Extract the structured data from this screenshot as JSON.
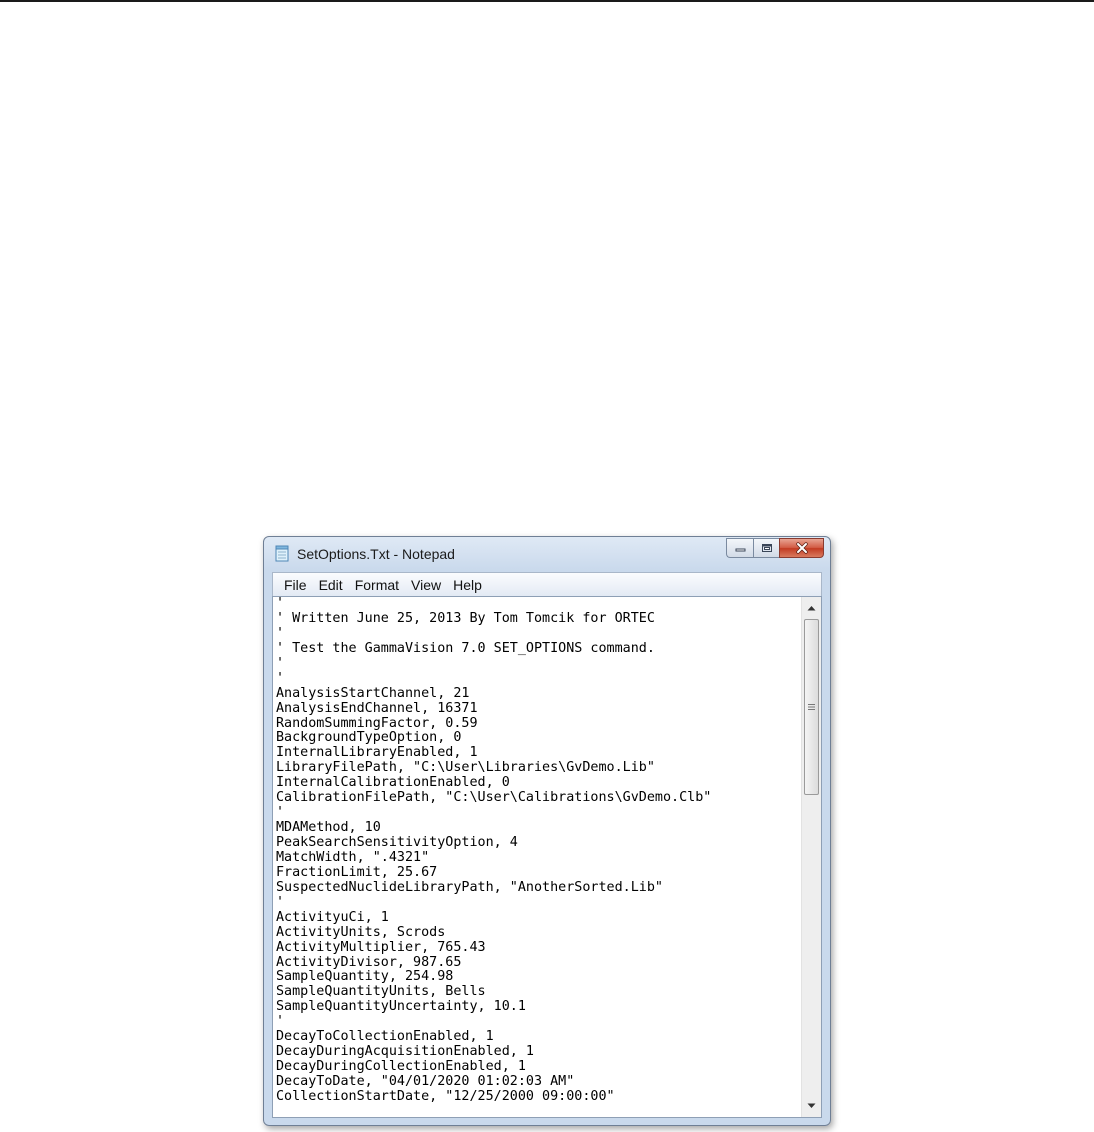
{
  "window": {
    "title": "SetOptions.Txt - Notepad",
    "app_icon": "notepad-icon",
    "caption_icons": [
      "minimize-icon",
      "maximize-icon",
      "close-icon"
    ]
  },
  "menu": {
    "items": [
      "File",
      "Edit",
      "Format",
      "View",
      "Help"
    ]
  },
  "editor": {
    "lines": [
      "'",
      "' Written June 25, 2013 By Tom Tomcik for ORTEC",
      "'",
      "' Test the GammaVision 7.0 SET_OPTIONS command.",
      "'",
      "'",
      "AnalysisStartChannel, 21",
      "AnalysisEndChannel, 16371",
      "RandomSummingFactor, 0.59",
      "BackgroundTypeOption, 0",
      "InternalLibraryEnabled, 1",
      "LibraryFilePath, \"C:\\User\\Libraries\\GvDemo.Lib\"",
      "InternalCalibrationEnabled, 0",
      "CalibrationFilePath, \"C:\\User\\Calibrations\\GvDemo.Clb\"",
      "'",
      "MDAMethod, 10",
      "PeakSearchSensitivityOption, 4",
      "MatchWidth, \".4321\"",
      "FractionLimit, 25.67",
      "SuspectedNuclideLibraryPath, \"AnotherSorted.Lib\"",
      "'",
      "ActivityuCi, 1",
      "ActivityUnits, Scrods",
      "ActivityMultiplier, 765.43",
      "ActivityDivisor, 987.65",
      "SampleQuantity, 254.98",
      "SampleQuantityUnits, Bells",
      "SampleQuantityUncertainty, 10.1",
      "'",
      "DecayToCollectionEnabled, 1",
      "DecayDuringAcquisitionEnabled, 1",
      "DecayDuringCollectionEnabled, 1",
      "DecayToDate, \"04/01/2020 01:02:03 AM\"",
      "CollectionStartDate, \"12/25/2000 09:00:00\""
    ]
  },
  "scrollbar": {
    "up_icon": "scroll-up-arrow-icon",
    "down_icon": "scroll-down-arrow-icon",
    "thumb_grip_icon": "grip-icon"
  }
}
